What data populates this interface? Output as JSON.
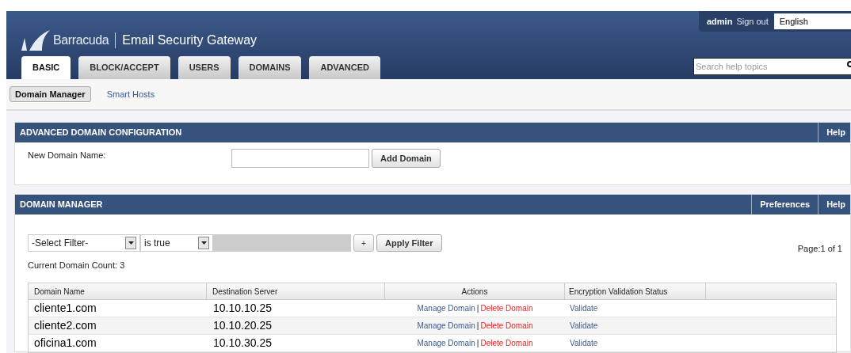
{
  "header": {
    "brand": "Barracuda",
    "product": "Email Security Gateway",
    "user": "admin",
    "sign_out": "Sign out",
    "language": "English",
    "search": {
      "placeholder": "Search help topics"
    }
  },
  "tabs": [
    {
      "label": "BASIC",
      "selected": true
    },
    {
      "label": "BLOCK/ACCEPT",
      "selected": false
    },
    {
      "label": "USERS",
      "selected": false
    },
    {
      "label": "DOMAINS",
      "selected": false
    },
    {
      "label": "ADVANCED",
      "selected": false
    }
  ],
  "subtabs": [
    {
      "label": "Domain Manager",
      "selected": true
    },
    {
      "label": "Smart Hosts",
      "selected": false
    }
  ],
  "config_panel": {
    "title": "ADVANCED DOMAIN CONFIGURATION",
    "help": "Help",
    "field_label": "New Domain Name:",
    "button": "Add Domain"
  },
  "manager_panel": {
    "title": "DOMAIN MANAGER",
    "preferences": "Preferences",
    "help": "Help",
    "filter_select": "-Select Filter-",
    "condition_select": "is true",
    "plus": "+",
    "apply": "Apply Filter",
    "page": "Page:1 of 1",
    "count": "Current Domain Count: 3",
    "columns": [
      "Domain Name",
      "Destination Server",
      "Actions",
      "Encryption Validation Status"
    ],
    "rows": [
      {
        "domain": "cliente1.com",
        "server": "10.10.10.25",
        "manage": "Manage Domain",
        "sep": "|",
        "delete": "Delete Domain",
        "validate": "Validate"
      },
      {
        "domain": "cliente2.com",
        "server": "10.10.20.25",
        "manage": "Manage Domain",
        "sep": "|",
        "delete": "Delete Domain",
        "validate": "Validate"
      },
      {
        "domain": "oficina1.com",
        "server": "10.10.30.25",
        "manage": "Manage Domain",
        "sep": "|",
        "delete": "Delete Domain",
        "validate": "Validate"
      }
    ]
  }
}
